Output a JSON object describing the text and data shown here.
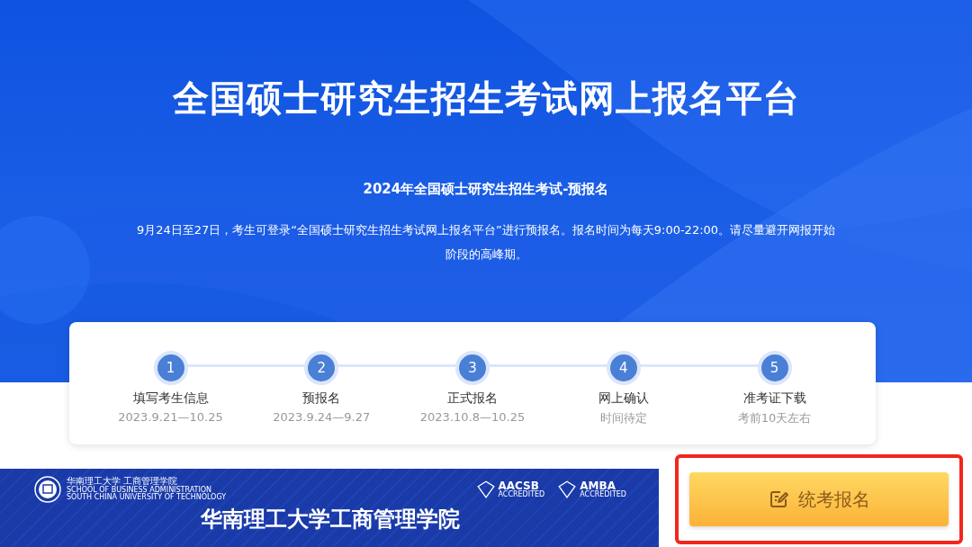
{
  "hero": {
    "title": "全国硕士研究生招生考试网上报名平台",
    "subtitle": "2024年全国硕士研究生招生考试-预报名",
    "notice": "9月24日至27日，考生可登录“全国硕士研究生招生考试网上报名平台”进行预报名。报名时间为每天9:00-22:00。请尽量避开网报开始阶段的高峰期。"
  },
  "steps": [
    {
      "number": "1",
      "name": "填写考生信息",
      "date": "2023.9.21—10.25"
    },
    {
      "number": "2",
      "name": "预报名",
      "date": "2023.9.24—9.27"
    },
    {
      "number": "3",
      "name": "正式报名",
      "date": "2023.10.8—10.25"
    },
    {
      "number": "4",
      "name": "网上确认",
      "date": "时间待定"
    },
    {
      "number": "5",
      "name": "准考证下载",
      "date": "考前10天左右"
    }
  ],
  "banner": {
    "school_cn": "华南理工大学 工商管理学院",
    "school_en": "SCHOOL OF BUSINESS ADMINISTRATION",
    "university_en": "SOUTH CHINA UNIVERSITY OF TECHNOLOGY",
    "badges": [
      {
        "name": "AACSB",
        "note": "ACCREDITED"
      },
      {
        "name": "AMBA",
        "note": "ACCREDITED"
      }
    ],
    "headline": "华南理工大学工商管理学院"
  },
  "register_button": {
    "label": "统考报名",
    "highlighted": true
  }
}
